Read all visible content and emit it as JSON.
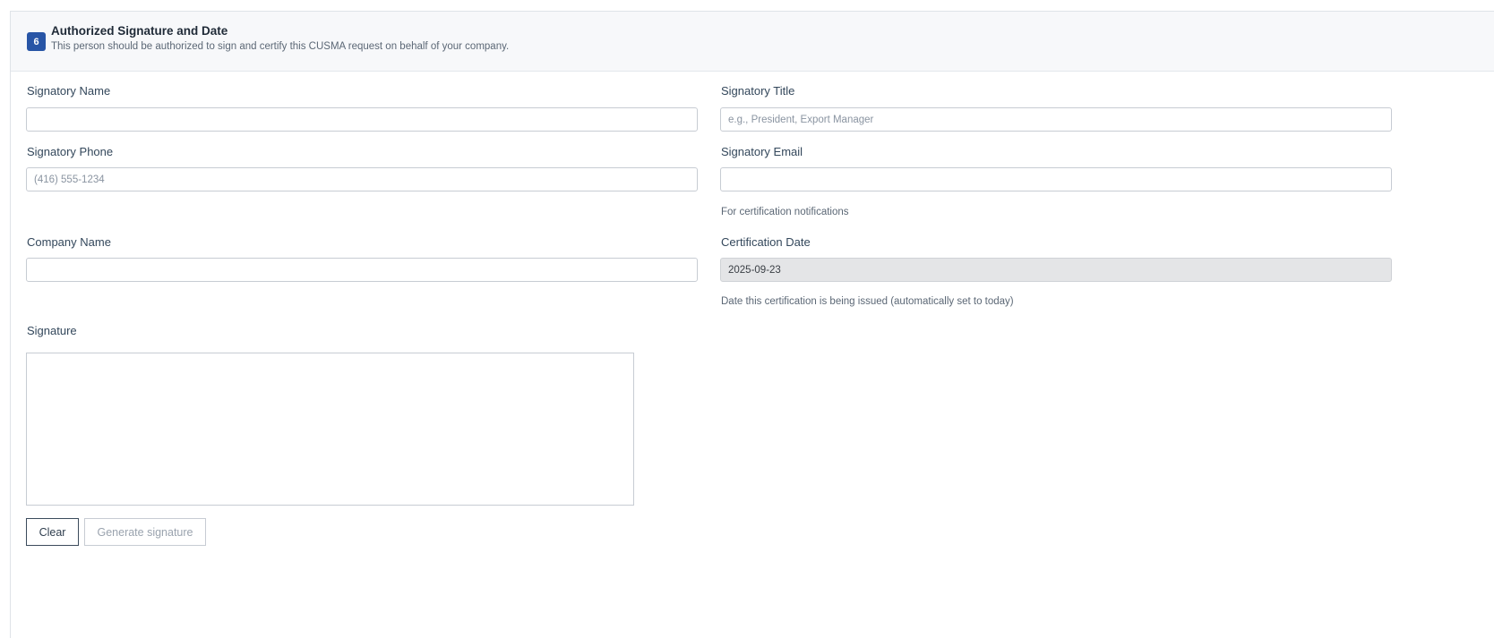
{
  "section": {
    "step_number": "6",
    "title": "Authorized Signature and Date",
    "subtitle": "This person should be authorized to sign and certify this CUSMA request on behalf of your company."
  },
  "fields": {
    "signatory_name": {
      "label": "Signatory Name",
      "value": "",
      "placeholder": ""
    },
    "signatory_title": {
      "label": "Signatory Title",
      "value": "",
      "placeholder": "e.g., President, Export Manager"
    },
    "signatory_phone": {
      "label": "Signatory Phone",
      "value": "",
      "placeholder": "(416) 555-1234"
    },
    "signatory_email": {
      "label": "Signatory Email",
      "value": "",
      "placeholder": "",
      "help": "For certification notifications"
    },
    "company_name": {
      "label": "Company Name",
      "value": "",
      "placeholder": ""
    },
    "certification_date": {
      "label": "Certification Date",
      "value": "2025-09-23",
      "help": "Date this certification is being issued (automatically set to today)"
    }
  },
  "signature": {
    "label": "Signature",
    "clear_label": "Clear",
    "generate_label": "Generate signature"
  }
}
